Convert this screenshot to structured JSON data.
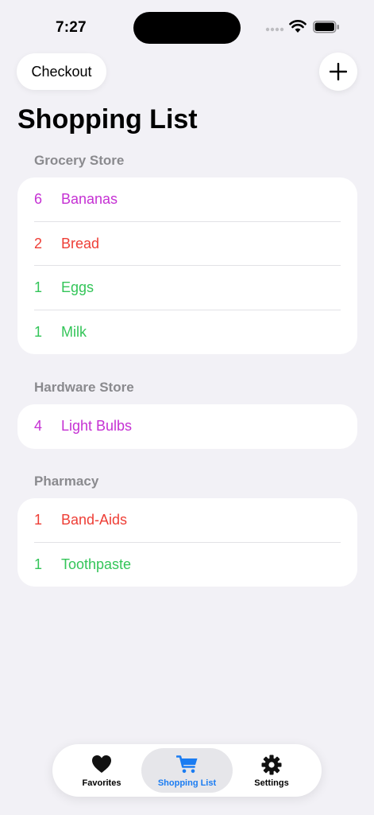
{
  "status_bar": {
    "time": "7:27"
  },
  "toolbar": {
    "checkout_label": "Checkout",
    "add_icon": "plus-icon"
  },
  "page": {
    "title": "Shopping List"
  },
  "sections": [
    {
      "header": "Grocery Store",
      "items": [
        {
          "qty": "6",
          "name": "Bananas",
          "color": "#c531d3"
        },
        {
          "qty": "2",
          "name": "Bread",
          "color": "#ee3e36"
        },
        {
          "qty": "1",
          "name": "Eggs",
          "color": "#34c559"
        },
        {
          "qty": "1",
          "name": "Milk",
          "color": "#34c559"
        }
      ]
    },
    {
      "header": "Hardware Store",
      "items": [
        {
          "qty": "4",
          "name": "Light Bulbs",
          "color": "#c531d3"
        }
      ]
    },
    {
      "header": "Pharmacy",
      "items": [
        {
          "qty": "1",
          "name": "Band-Aids",
          "color": "#ee3e36"
        },
        {
          "qty": "1",
          "name": "Toothpaste",
          "color": "#34c559"
        }
      ]
    }
  ],
  "tabs": [
    {
      "label": "Favorites",
      "icon": "heart-icon",
      "selected": false
    },
    {
      "label": "Shopping List",
      "icon": "cart-icon",
      "selected": true
    },
    {
      "label": "Settings",
      "icon": "gear-icon",
      "selected": false
    }
  ],
  "colors": {
    "accent": "#1a7cf2",
    "background": "#f2f1f6"
  }
}
